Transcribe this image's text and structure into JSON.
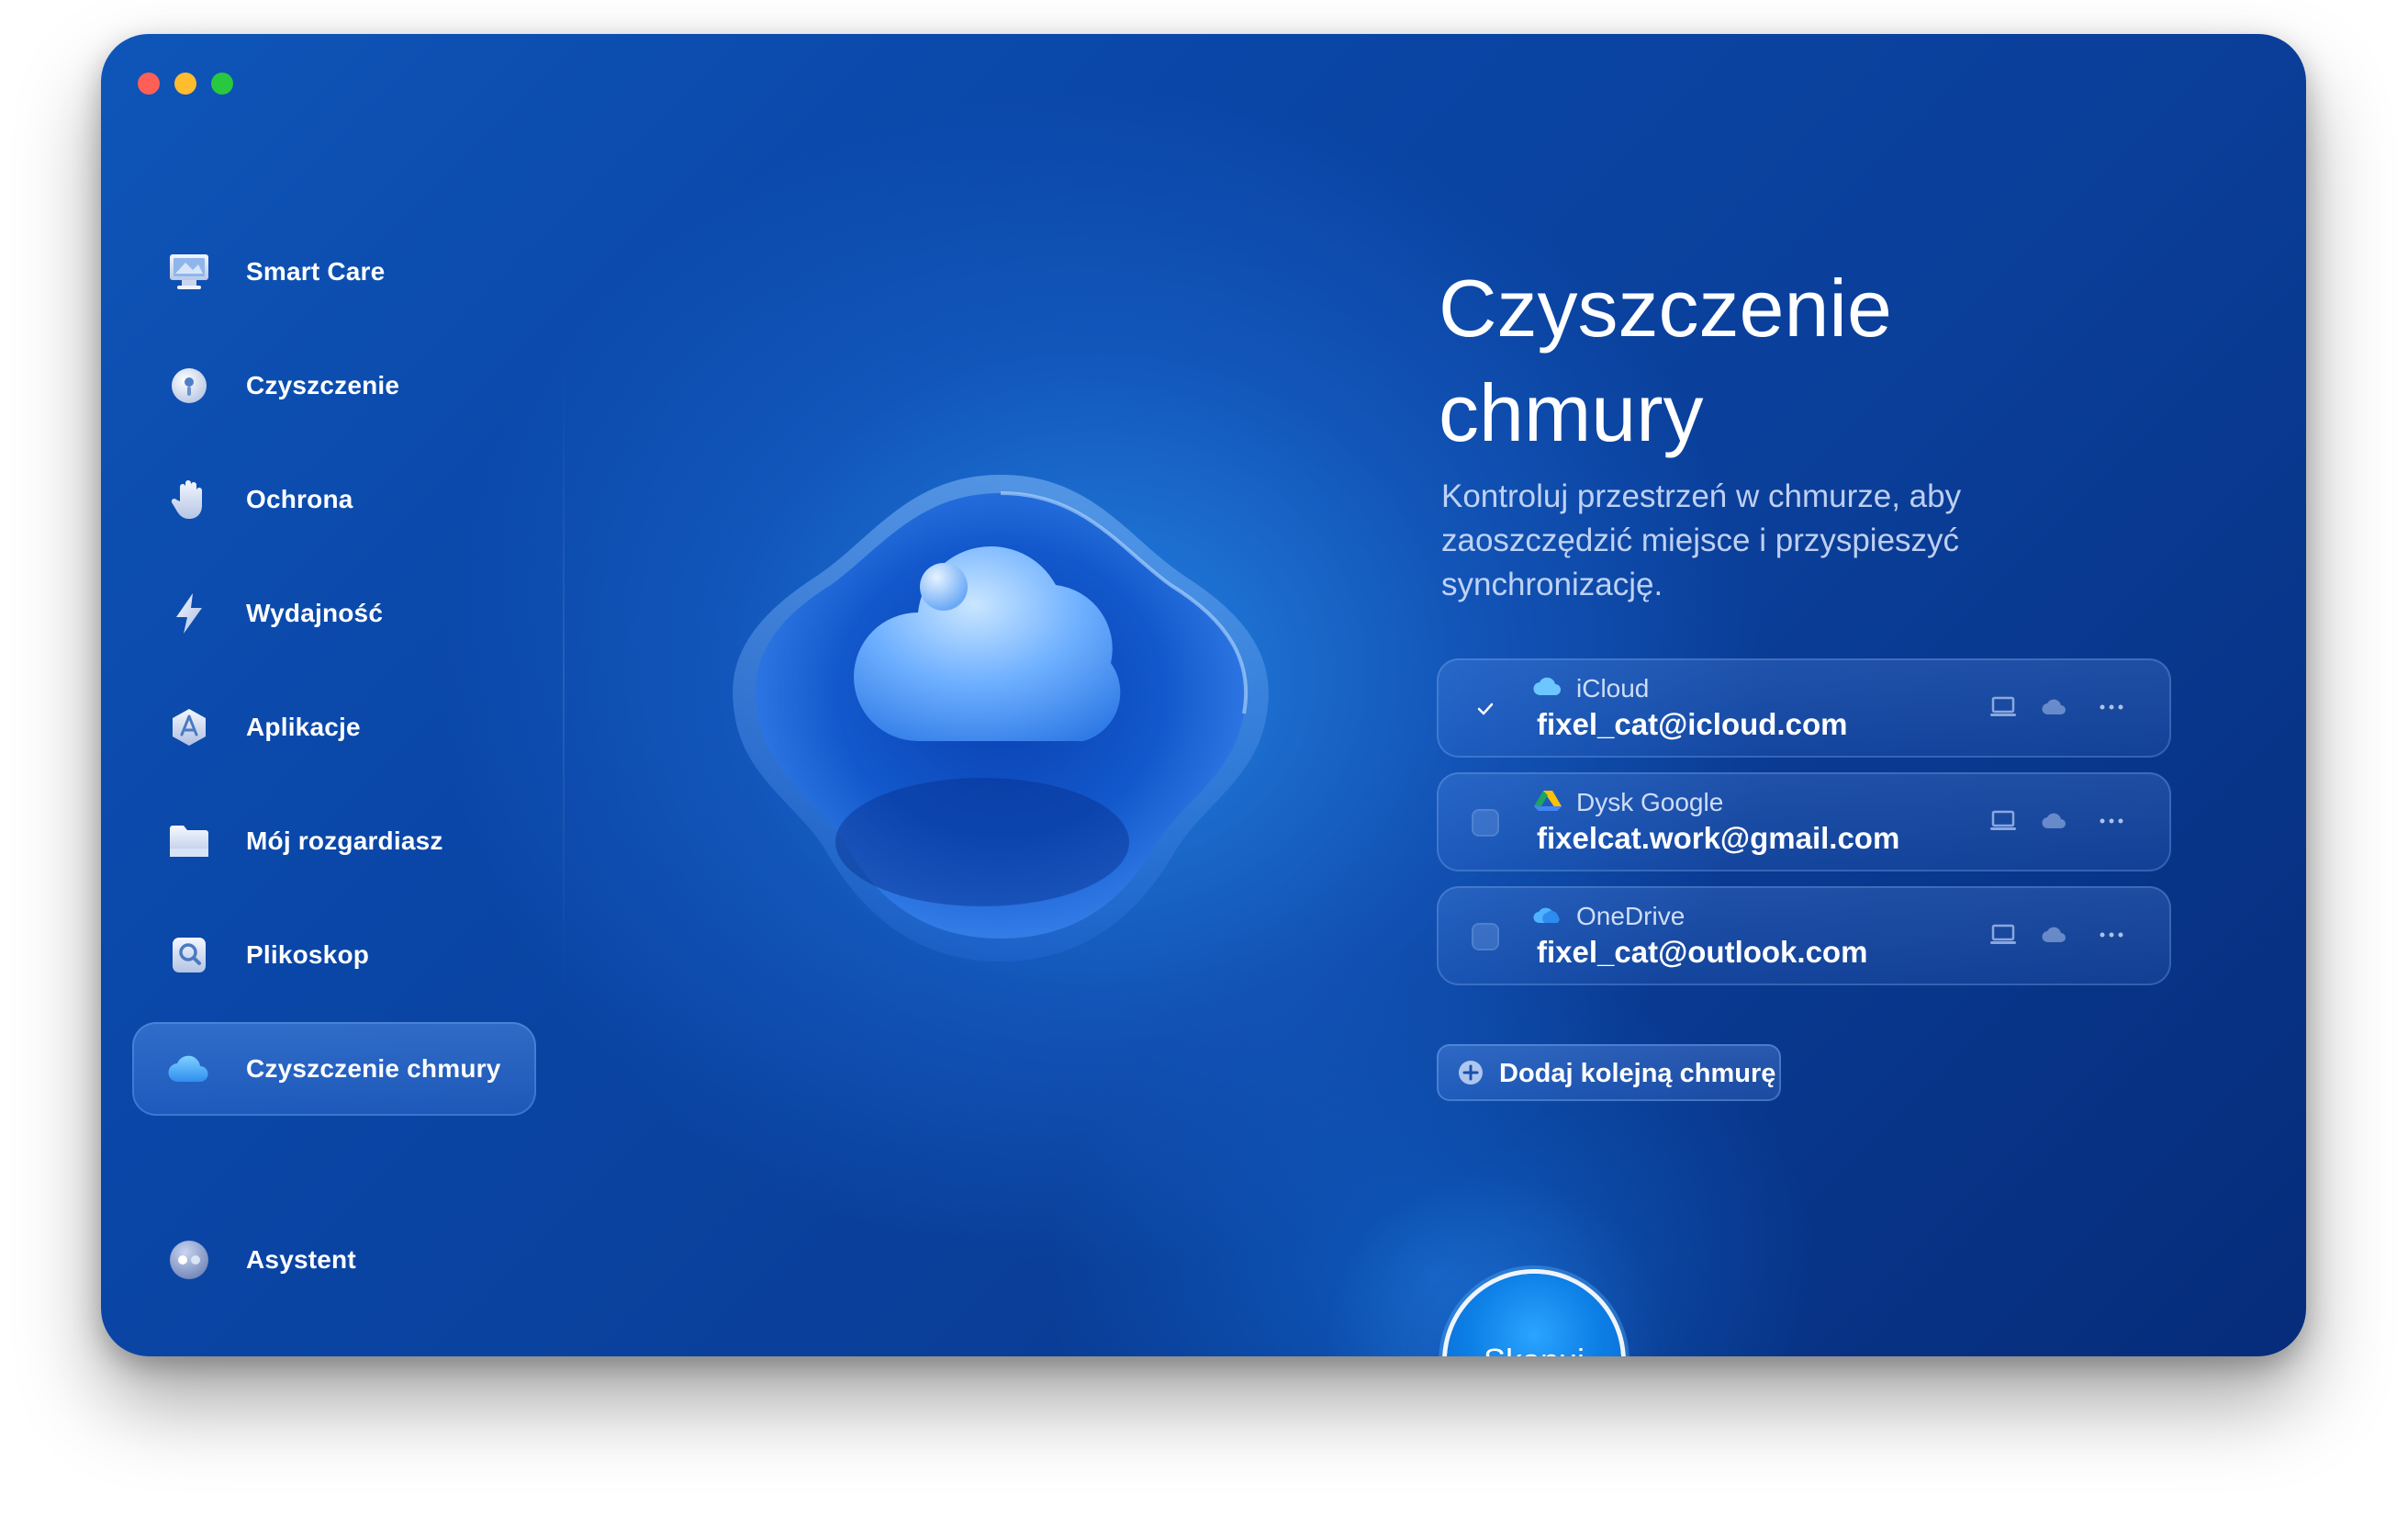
{
  "sidebar": {
    "items": [
      {
        "label": "Smart Care",
        "icon": "monitor-icon"
      },
      {
        "label": "Czyszczenie",
        "icon": "disk-icon"
      },
      {
        "label": "Ochrona",
        "icon": "hand-icon"
      },
      {
        "label": "Wydajność",
        "icon": "lightning-icon"
      },
      {
        "label": "Aplikacje",
        "icon": "apps-icon"
      },
      {
        "label": "Mój rozgardiasz",
        "icon": "folder-icon"
      },
      {
        "label": "Plikoskop",
        "icon": "space-lens-icon"
      },
      {
        "label": "Czyszczenie chmury",
        "icon": "cloud-icon",
        "active": true
      }
    ],
    "assistant_label": "Asystent"
  },
  "main": {
    "title_line1": "Czyszczenie",
    "title_line2": "chmury",
    "subtitle_line1": "Kontroluj przestrzeń w chmurze, aby",
    "subtitle_line2": "zaoszczędzić miejsce i przyspieszyć",
    "subtitle_line3": "synchronizację.",
    "accounts": [
      {
        "service": "iCloud",
        "email": "fixel_cat@icloud.com",
        "checked": true,
        "icon": "icloud-icon"
      },
      {
        "service": "Dysk Google",
        "email": "fixelcat.work@gmail.com",
        "checked": false,
        "icon": "google-drive-icon"
      },
      {
        "service": "OneDrive",
        "email": "fixel_cat@outlook.com",
        "checked": false,
        "icon": "onedrive-icon"
      }
    ],
    "add_cloud_label": "Dodaj kolejną chmurę",
    "scan_label": "Skanuj"
  },
  "colors": {
    "window_bg": "#0a47a8",
    "accent": "#0d7fe6",
    "traffic_red": "#fe5f57",
    "traffic_yellow": "#febc2e",
    "traffic_green": "#28c840"
  }
}
